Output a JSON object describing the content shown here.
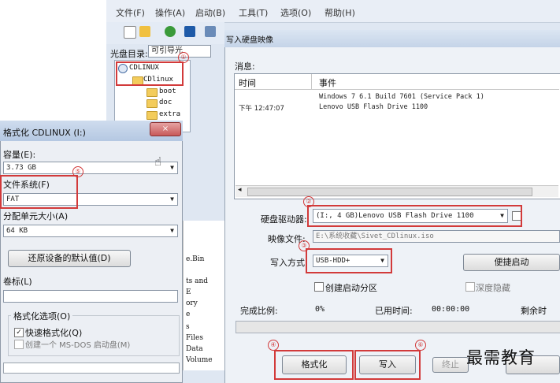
{
  "menu": [
    "文件(F)",
    "操作(A)",
    "启动(B)",
    "工具(T)",
    "选项(O)",
    "帮助(H)"
  ],
  "disc_dir": {
    "label": "光盘目录:",
    "value": "可引导光"
  },
  "tree": {
    "root": "CDLINUX",
    "child": "CDlinux",
    "items": [
      "boot",
      "doc",
      "extra"
    ]
  },
  "file_list_partial": [
    "e.Bin",
    "ts and",
    "E",
    "ory",
    "e",
    "s",
    "Files",
    "Data",
    "Volume"
  ],
  "format_dialog": {
    "title": "格式化 CDLINUX (I:)",
    "close": "×",
    "capacity_label": "容量(E):",
    "capacity_value": "3.73 GB",
    "filesystem_label": "文件系统(F)",
    "filesystem_value": "FAT",
    "alloc_label": "分配单元大小(A)",
    "alloc_value": "64 KB",
    "restore_button": "还原设备的默认值(D)",
    "volume_label": "卷标(L)",
    "volume_value": "",
    "options_label": "格式化选项(O)",
    "quick_format": "快速格式化(Q)",
    "quick_format_checked": true,
    "msdos_disk": "创建一个 MS-DOS 启动盘(M)",
    "msdos_checked": false
  },
  "write_dialog": {
    "title": "写入硬盘映像",
    "messages_label": "消息:",
    "col_time": "时间",
    "col_event": "事件",
    "log": [
      {
        "time": "",
        "event": "Windows 7 6.1 Build 7601 (Service Pack 1)"
      },
      {
        "time": "下午 12:47:07",
        "event": "Lenovo  USB Flash Drive 1100"
      }
    ],
    "drive_label": "硬盘驱动器:",
    "drive_value": "(I:, 4 GB)Lenovo  USB Flash Drive 1100",
    "image_label": "映像文件:",
    "image_value": "E:\\系统收藏\\Sivet_CDlinux.iso",
    "method_label": "写入方式:",
    "method_value": "USB-HDD+",
    "quick_boot_button": "便捷启动",
    "create_partition": "创建启动分区",
    "hide_label": "深度隐藏",
    "progress_label": "完成比例:",
    "progress_value": "0%",
    "elapsed_label": "已用时间:",
    "elapsed_value": "00:00:00",
    "remaining_label": "剩余时",
    "progress_fraction": 0,
    "format_button": "格式化",
    "write_button": "写入",
    "stop_button": "终止"
  },
  "markers": [
    "①",
    "②",
    "③",
    "④",
    "⑤",
    "⑥"
  ],
  "watermark": "最需教育",
  "accent_red": "#d23a3a"
}
